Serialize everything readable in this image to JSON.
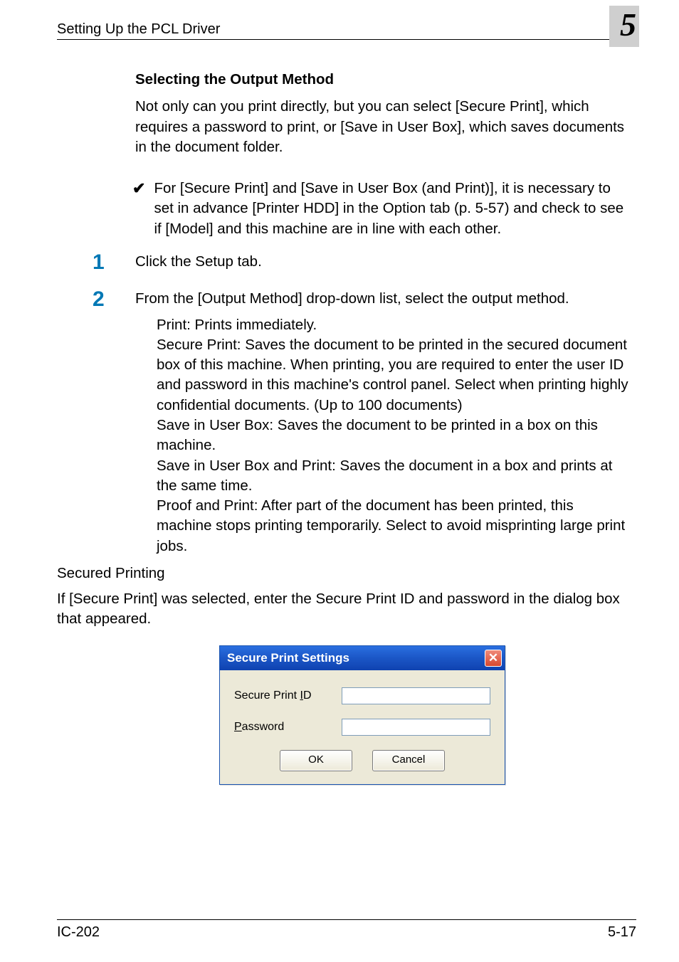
{
  "header": {
    "section": "Setting Up the PCL Driver",
    "chapter_number": "5"
  },
  "subheading": "Selecting the Output Method",
  "intro_para": "Not only can you print directly, but you can select [Secure Print], which requires a password to print, or [Save in User Box], which saves documents in the document folder.",
  "checkmark_note": "For [Secure Print] and [Save in User Box (and Print)], it is necessary to set in advance [Printer HDD] in the Option tab (p. 5-57) and check to see if [Model] and this machine are in line with each other.",
  "steps": [
    {
      "num": "1",
      "text": "Click the Setup tab."
    },
    {
      "num": "2",
      "text": "From the [Output Method] drop-down list, select the output method."
    }
  ],
  "step2_details": "Print: Prints immediately.\nSecure Print: Saves the document to be printed in the secured document box of this machine. When printing, you are required to enter the user ID and password in this machine's control panel. Select when printing highly confidential documents. (Up to 100 documents)\nSave in User Box: Saves the document to be printed in a box on this machine.\nSave in User Box and Print: Saves the document in a box and prints at the same time.\nProof and Print: After part of the document has been printed, this machine stops printing temporarily. Select to avoid misprinting large print jobs.",
  "secured_heading": "Secured Printing",
  "secured_desc": "If [Secure Print] was selected, enter the Secure Print ID and password in the dialog box that appeared.",
  "dialog": {
    "title": "Secure Print Settings",
    "close_label": "✕",
    "field1_prefix": "Secure Print ",
    "field1_hotkey": "I",
    "field1_suffix": "D",
    "field1_value": "",
    "field2_hotkey": "P",
    "field2_rest": "assword",
    "field2_value": "",
    "ok": "OK",
    "cancel": "Cancel"
  },
  "footer": {
    "left": "IC-202",
    "right": "5-17"
  }
}
